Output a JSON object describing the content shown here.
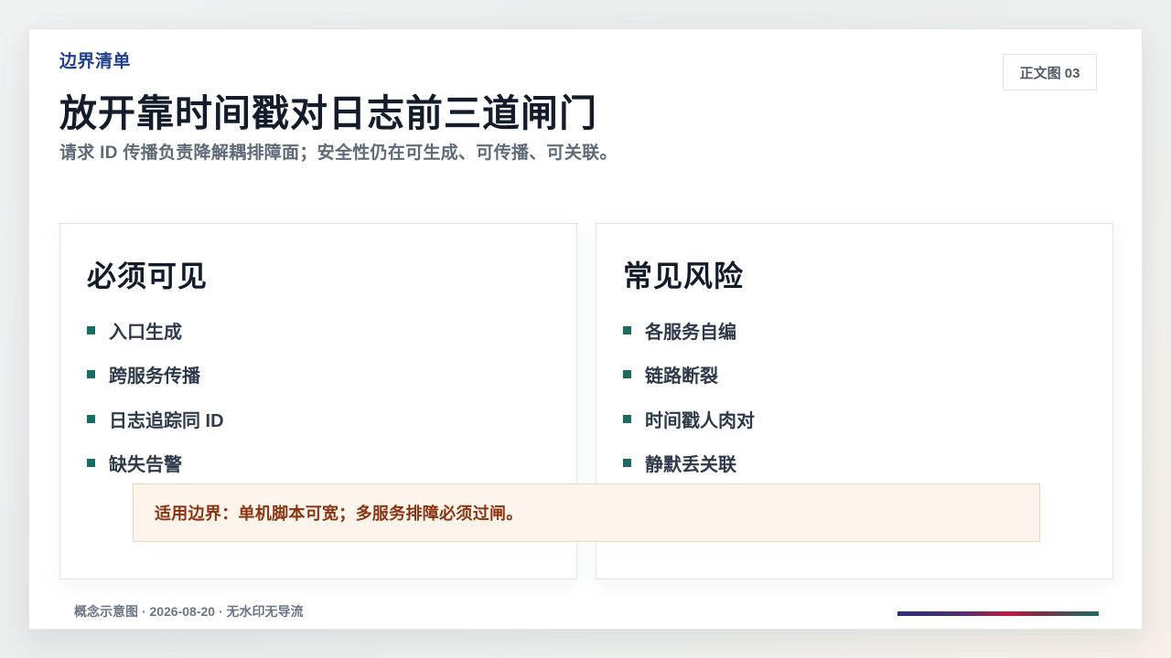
{
  "header": {
    "eyebrow": "边界清单",
    "page_tag": "正文图 03",
    "title": "放开靠时间戳对日志前三道闸门",
    "subtitle": "请求 ID 传播负责降解耦排障面；安全性仍在可生成、可传播、可关联。"
  },
  "cards": [
    {
      "heading": "必须可见",
      "items": [
        "入口生成",
        "跨服务传播",
        "日志追踪同 ID",
        "缺失告警"
      ]
    },
    {
      "heading": "常见风险",
      "items": [
        "各服务自编",
        "链路断裂",
        "时间戳人肉对",
        "静默丢关联"
      ]
    }
  ],
  "callout": "适用边界：单机脚本可宽；多服务排障必须过闸。",
  "footer": "概念示意图 · 2026-08-20 · 无水印无导流",
  "colors": {
    "eyebrow": "#1f3f8f",
    "bullet": "#1a6b64",
    "callout_text": "#8a3412",
    "callout_bg": "#fdf4ec"
  }
}
